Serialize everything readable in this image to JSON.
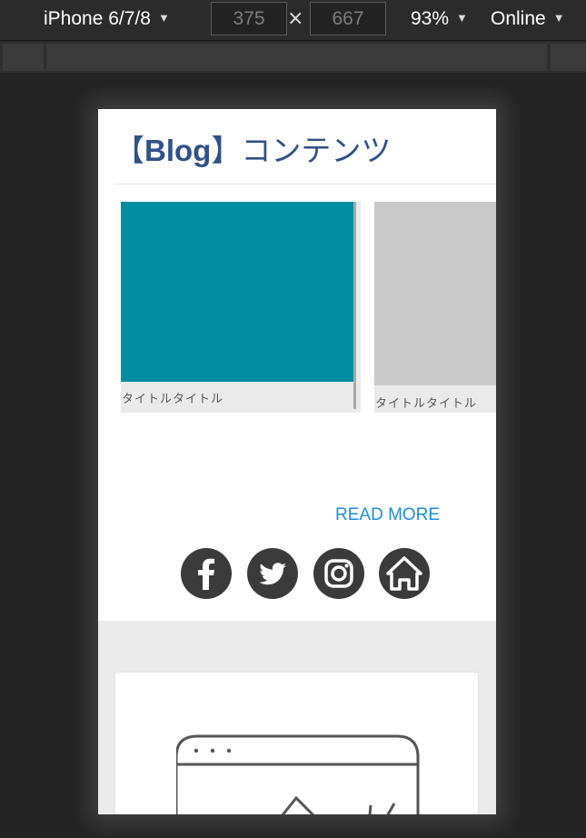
{
  "toolbar": {
    "device": "iPhone 6/7/8",
    "width": "375",
    "times": "×",
    "height": "667",
    "zoom": "93%",
    "network": "Online",
    "caret": "▼"
  },
  "page": {
    "heading_bracket_open": "【",
    "heading_blog": "Blog",
    "heading_bracket_close": "】",
    "heading_rest": "コンテンツ",
    "cards": [
      {
        "title": "タイトルタイトル",
        "thumb_color": "#008ea0"
      },
      {
        "title": "タイトルタイトル",
        "thumb_color": "#c9c9c9"
      }
    ],
    "read_more": "READ MORE",
    "social": [
      "facebook-icon",
      "twitter-icon",
      "instagram-icon",
      "home-icon"
    ],
    "colors": {
      "heading": "#2f5287",
      "link": "#1b8cdb",
      "icon_circle": "#3b3b3b",
      "gray_section": "#ebebeb"
    }
  }
}
